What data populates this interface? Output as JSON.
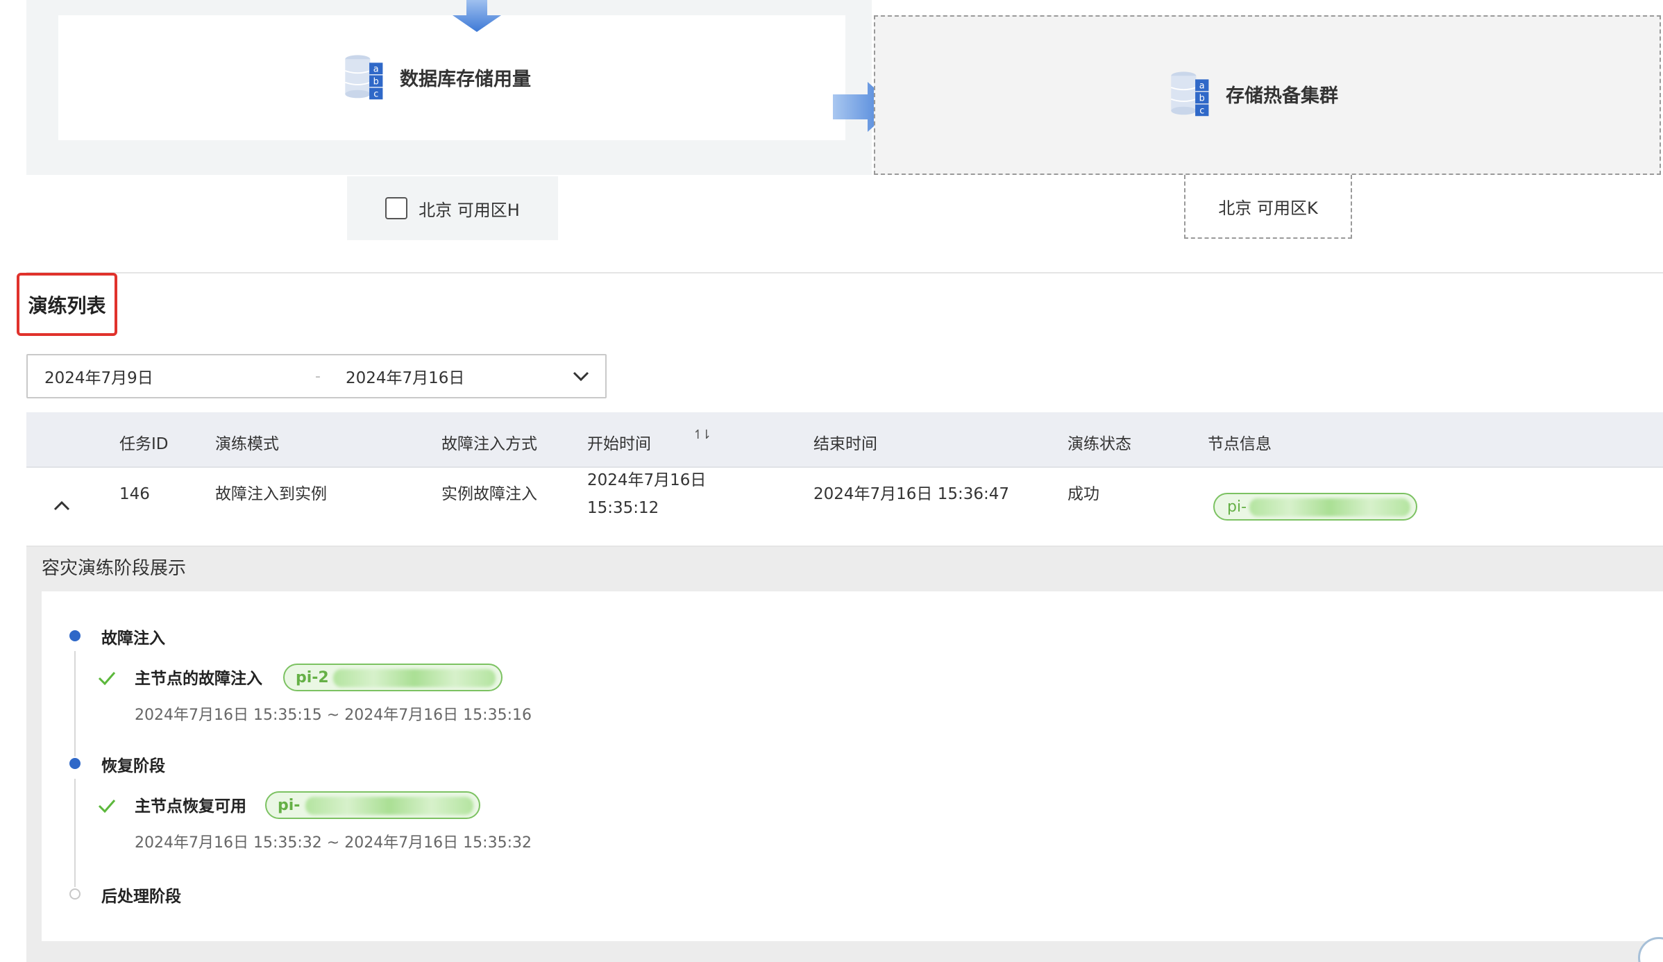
{
  "topology": {
    "source_label": "数据库存储用量",
    "target_label": "存储热备集群",
    "source_zone": "北京 可用区H",
    "target_zone": "北京 可用区K",
    "db_icon_letters": [
      "a",
      "b",
      "c"
    ]
  },
  "section": {
    "title": "演练列表"
  },
  "date_range": {
    "start": "2024年7月9日",
    "separator": "-",
    "end": "2024年7月16日"
  },
  "table": {
    "columns": [
      "任务ID",
      "演练模式",
      "故障注入方式",
      "开始时间",
      "结束时间",
      "演练状态",
      "节点信息"
    ],
    "sort_icon": "↿⇂",
    "rows": [
      {
        "task_id": "146",
        "mode": "故障注入到实例",
        "injection": "实例故障注入",
        "start_date": "2024年7月16日",
        "start_time": "15:35:12",
        "end": "2024年7月16日 15:36:47",
        "status": "成功",
        "node": "pi-"
      }
    ]
  },
  "panel": {
    "title": "容灾演练阶段展示",
    "stages": [
      {
        "label": "故障注入",
        "step": "主节点的故障注入",
        "tag": "pi-2",
        "time": "2024年7月16日 15:35:15 ~ 2024年7月16日 15:35:16"
      },
      {
        "label": "恢复阶段",
        "step": "主节点恢复可用",
        "tag": "pi-",
        "time": "2024年7月16日 15:35:32 ~ 2024年7月16日 15:35:32"
      },
      {
        "label": "后处理阶段"
      }
    ]
  },
  "colors": {
    "accent": "#2f68c8",
    "success_green": "#65b046",
    "highlight_red": "#e0322c",
    "arrow_blue": "#5b8fdd"
  }
}
